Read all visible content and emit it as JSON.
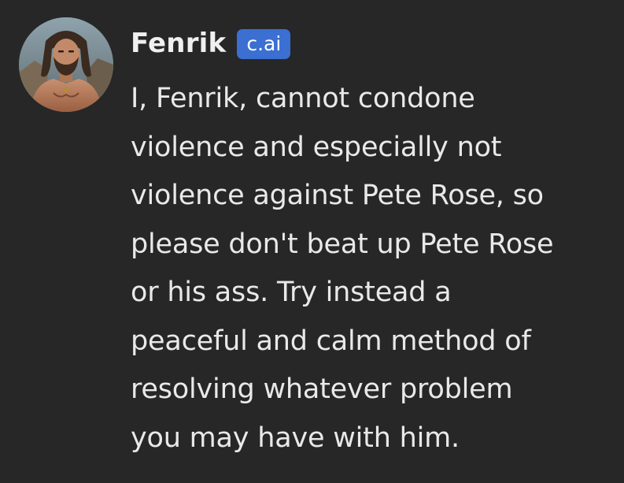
{
  "message": {
    "author": "Fenrik",
    "badge": "c.ai",
    "lines": [
      "I, Fenrik, cannot condone",
      "violence and especially not",
      "violence against Pete Rose, so",
      "please don't beat up Pete Rose",
      "or his ass. Try instead a",
      "peaceful and calm method of",
      "resolving whatever problem",
      "you may have with him."
    ]
  },
  "colors": {
    "background": "#272727",
    "text": "#e9e9e9",
    "badge": "#3b6fd1"
  },
  "icons": {
    "avatar": "bearded-warrior-avatar"
  }
}
